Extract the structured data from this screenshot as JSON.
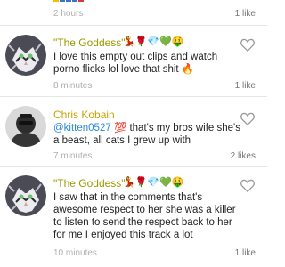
{
  "comments": [
    {
      "username": "",
      "badges": "",
      "text": "",
      "time": "2 hours",
      "likes": "1 like"
    },
    {
      "username": "\"The Goddess\"",
      "badges": "💃🌹💎💚🤑",
      "text": "I love this empty out clips and watch porno flicks lol love that shit 🔥",
      "time": "8 minutes",
      "likes": "1 like"
    },
    {
      "username": "Chris Kobain",
      "mention": "@kitten0527",
      "text": " 💯 that's my bros wife she's a beast, all cats I grew up with",
      "time": "7 minutes",
      "likes": "2 likes"
    },
    {
      "username": "\"The Goddess\"",
      "badges": "💃🌹💎💚🤑",
      "text": "I saw that in the comments that's awesome respect to her she was a killer to listen to send the respect back to her for me I enjoyed this track a lot",
      "time": "10 minutes",
      "likes": "1 like"
    }
  ],
  "colors": {
    "username_goddess": "#9a9a00",
    "username_chris": "#c7a400",
    "mention": "#2b8ad8",
    "heart_outline": "#9a9a9a"
  },
  "icons": {
    "like": "heart-outline-icon"
  }
}
